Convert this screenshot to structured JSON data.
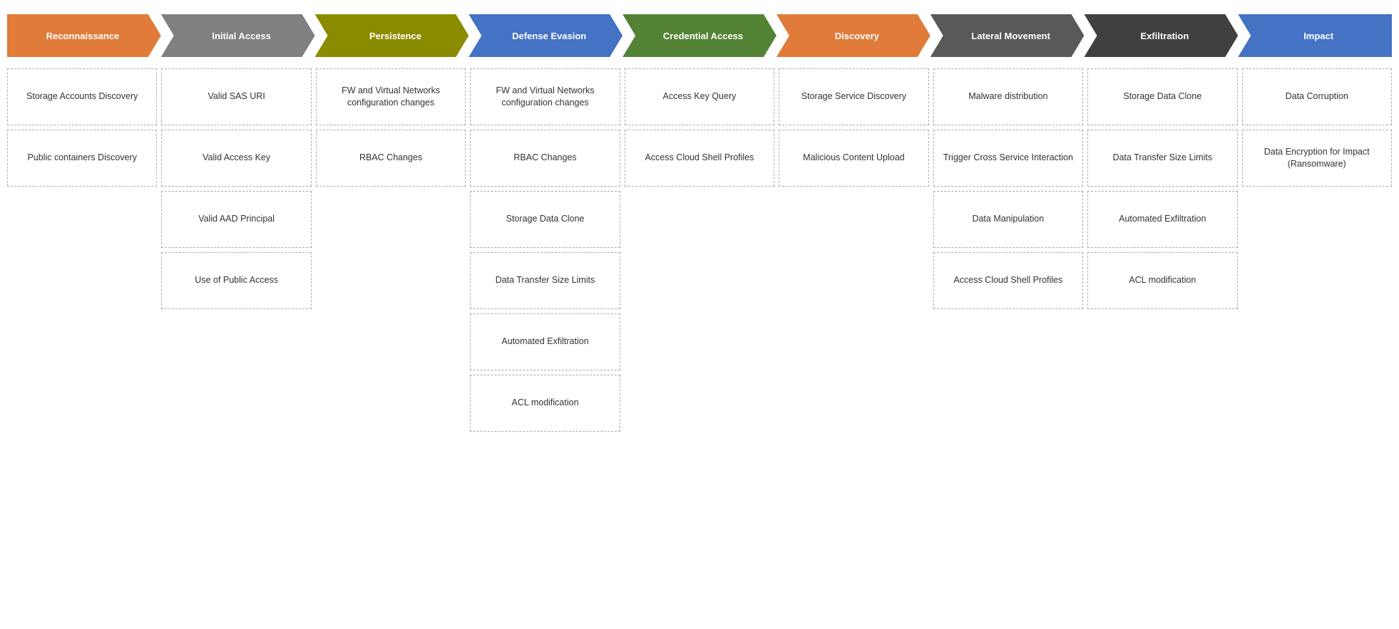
{
  "headers": [
    {
      "id": "reconnaissance",
      "label": "Reconnaissance",
      "color": "color-orange",
      "position": "first"
    },
    {
      "id": "initial-access",
      "label": "Initial Access",
      "color": "color-gray",
      "position": "middle"
    },
    {
      "id": "persistence",
      "label": "Persistence",
      "color": "color-olive",
      "position": "middle"
    },
    {
      "id": "defense-evasion",
      "label": "Defense Evasion",
      "color": "color-blue",
      "position": "middle"
    },
    {
      "id": "credential-access",
      "label": "Credential Access",
      "color": "color-green",
      "position": "middle"
    },
    {
      "id": "discovery",
      "label": "Discovery",
      "color": "color-orange2",
      "position": "middle"
    },
    {
      "id": "lateral-movement",
      "label": "Lateral Movement",
      "color": "color-darkgray",
      "position": "middle"
    },
    {
      "id": "exfiltration",
      "label": "Exfiltration",
      "color": "color-charcoal",
      "position": "middle"
    },
    {
      "id": "impact",
      "label": "Impact",
      "color": "color-lightblue",
      "position": "last"
    }
  ],
  "columns": {
    "reconnaissance": [
      {
        "text": "Storage Accounts Discovery"
      },
      {
        "text": "Public containers Discovery"
      }
    ],
    "initial-access": [
      {
        "text": "Valid SAS URI"
      },
      {
        "text": "Valid Access Key"
      },
      {
        "text": "Valid AAD Principal"
      },
      {
        "text": "Use of Public Access"
      }
    ],
    "persistence": [
      {
        "text": "FW and Virtual Networks configuration changes"
      },
      {
        "text": "RBAC Changes"
      }
    ],
    "defense-evasion": [
      {
        "text": "FW and Virtual Networks configuration changes"
      },
      {
        "text": "RBAC Changes"
      },
      {
        "text": "Storage Data Clone"
      },
      {
        "text": "Data Transfer Size Limits"
      },
      {
        "text": "Automated Exfiltration"
      },
      {
        "text": "ACL modification"
      }
    ],
    "credential-access": [
      {
        "text": "Access Key Query"
      },
      {
        "text": "Access Cloud Shell Profiles"
      }
    ],
    "discovery": [
      {
        "text": "Storage Service Discovery"
      },
      {
        "text": "Malicious Content Upload"
      }
    ],
    "lateral-movement": [
      {
        "text": "Malware distribution"
      },
      {
        "text": "Trigger Cross Service Interaction"
      },
      {
        "text": "Data Manipulation"
      },
      {
        "text": "Access Cloud Shell Profiles"
      }
    ],
    "exfiltration": [
      {
        "text": "Storage Data Clone"
      },
      {
        "text": "Data Transfer Size Limits"
      },
      {
        "text": "Automated Exfiltration"
      },
      {
        "text": "ACL modification"
      }
    ],
    "impact": [
      {
        "text": "Data Corruption"
      },
      {
        "text": "Data Encryption for Impact (Ransomware)"
      }
    ]
  }
}
